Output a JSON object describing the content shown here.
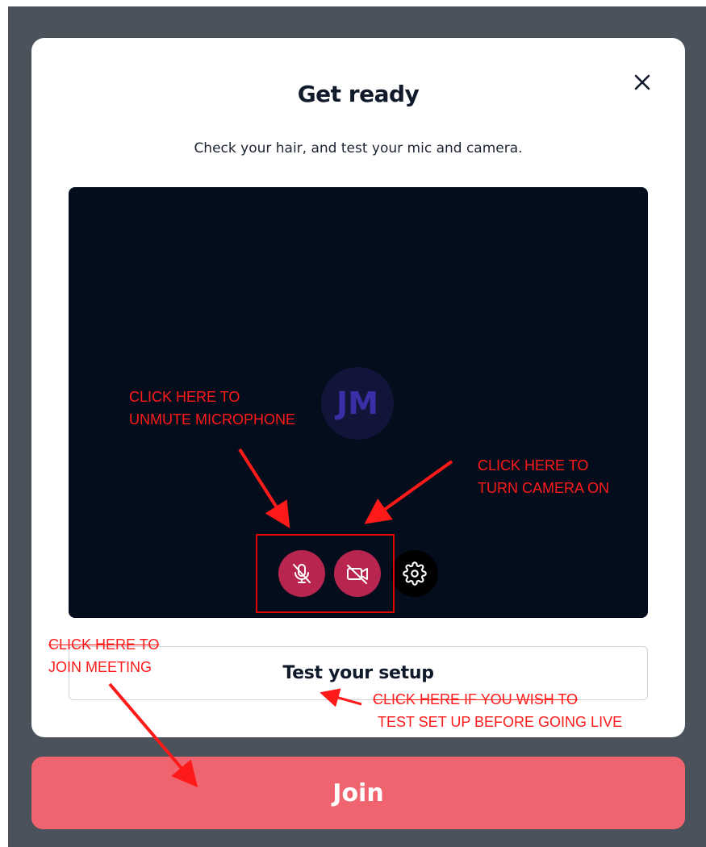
{
  "dialog": {
    "title": "Get ready",
    "subtitle": "Check your hair, and test your mic and camera.",
    "close_icon": "close-icon"
  },
  "preview": {
    "avatar_initials": "JM",
    "controls": [
      {
        "name": "microphone-toggle",
        "icon": "mic-off-icon",
        "state": "muted",
        "color": "#b8254f"
      },
      {
        "name": "camera-toggle",
        "icon": "video-off-icon",
        "state": "off",
        "color": "#b8254f"
      },
      {
        "name": "settings",
        "icon": "gear-icon",
        "color": "#000000"
      }
    ]
  },
  "buttons": {
    "test_setup": "Test your setup",
    "join": "Join"
  },
  "annotations": {
    "mic": [
      "CLICK HERE TO",
      "UNMUTE MICROPHONE"
    ],
    "camera": [
      "CLICK HERE TO",
      "TURN CAMERA ON"
    ],
    "join": [
      "CLICK HERE TO",
      "JOIN MEETING"
    ],
    "test": [
      "CLICK HERE IF YOU WISH TO",
      "TEST SET UP BEFORE GOING LIVE"
    ],
    "color": "#ff1a1a"
  }
}
